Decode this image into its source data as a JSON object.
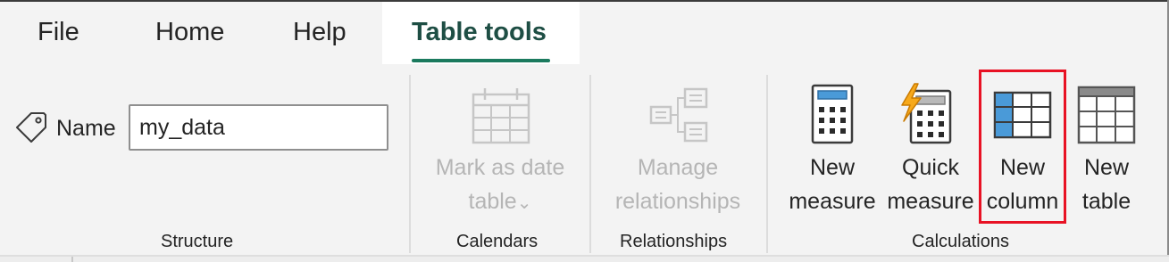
{
  "tabs": {
    "file": "File",
    "home": "Home",
    "help": "Help",
    "table_tools": "Table tools"
  },
  "structure": {
    "name_label": "Name",
    "name_value": "my_data",
    "group_label": "Structure"
  },
  "calendars": {
    "mark_as_date_line1": "Mark as date",
    "mark_as_date_line2": "table",
    "dropdown_glyph": "⌄",
    "group_label": "Calendars"
  },
  "relationships": {
    "manage_line1": "Manage",
    "manage_line2": "relationships",
    "group_label": "Relationships"
  },
  "calculations": {
    "new_measure_line1": "New",
    "new_measure_line2": "measure",
    "quick_measure_line1": "Quick",
    "quick_measure_line2": "measure",
    "new_column_line1": "New",
    "new_column_line2": "column",
    "new_table_line1": "New",
    "new_table_line2": "table",
    "group_label": "Calculations"
  },
  "colors": {
    "accent_green": "#1b7a5e",
    "highlight_red": "#e81224",
    "column_blue": "#4a9ad8",
    "disabled_gray": "#b5b5b5"
  },
  "icons": {
    "name": "tag-icon",
    "mark_as_date": "calendar-table-icon",
    "manage_relationships": "relationship-diagram-icon",
    "new_measure": "calculator-icon",
    "quick_measure": "lightning-calculator-icon",
    "new_column": "table-column-icon",
    "new_table": "table-icon"
  }
}
